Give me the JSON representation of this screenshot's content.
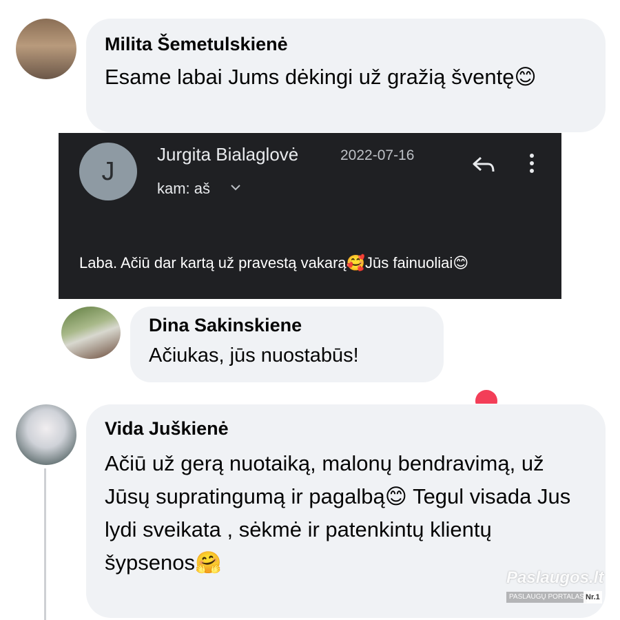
{
  "comments": [
    {
      "author": "Milita Šemetulskienė",
      "text": "Esame labai Jums dėkingi už gražią šventę😊"
    },
    {
      "author": "Dina Sakinskiene",
      "text": "Ačiukas, jūs nuostabūs!"
    },
    {
      "author": "Vida Juškienė",
      "text": "Ačiū už gerą nuotaiką, malonų bendravimą, už Jūsų supratingumą ir pagalbą😊 Tegul visada Jus lydi sveikata , sėkmė ir patenkintų klientų šypsenos🤗"
    }
  ],
  "email": {
    "avatar_letter": "J",
    "sender": "Jurgita Bialaglovė",
    "date": "2022-07-16",
    "to": "kam: aš",
    "body": "Laba. Ačiū dar kartą už pravestą vakarą🥰Jūs fainuoliai😊",
    "icons": {
      "reply": "reply-icon",
      "more": "more-vert-icon",
      "expand": "chevron-down-icon"
    }
  },
  "watermark": {
    "title": "Paslaugos.lt",
    "subtitle": "PASLAUGŲ PORTALAS",
    "badge": "Nr.1"
  },
  "colors": {
    "bubble": "#f0f2f5",
    "email_bg": "#1f2023",
    "email_avatar": "#8e9aa3",
    "reaction_heart": "#f33e58"
  }
}
